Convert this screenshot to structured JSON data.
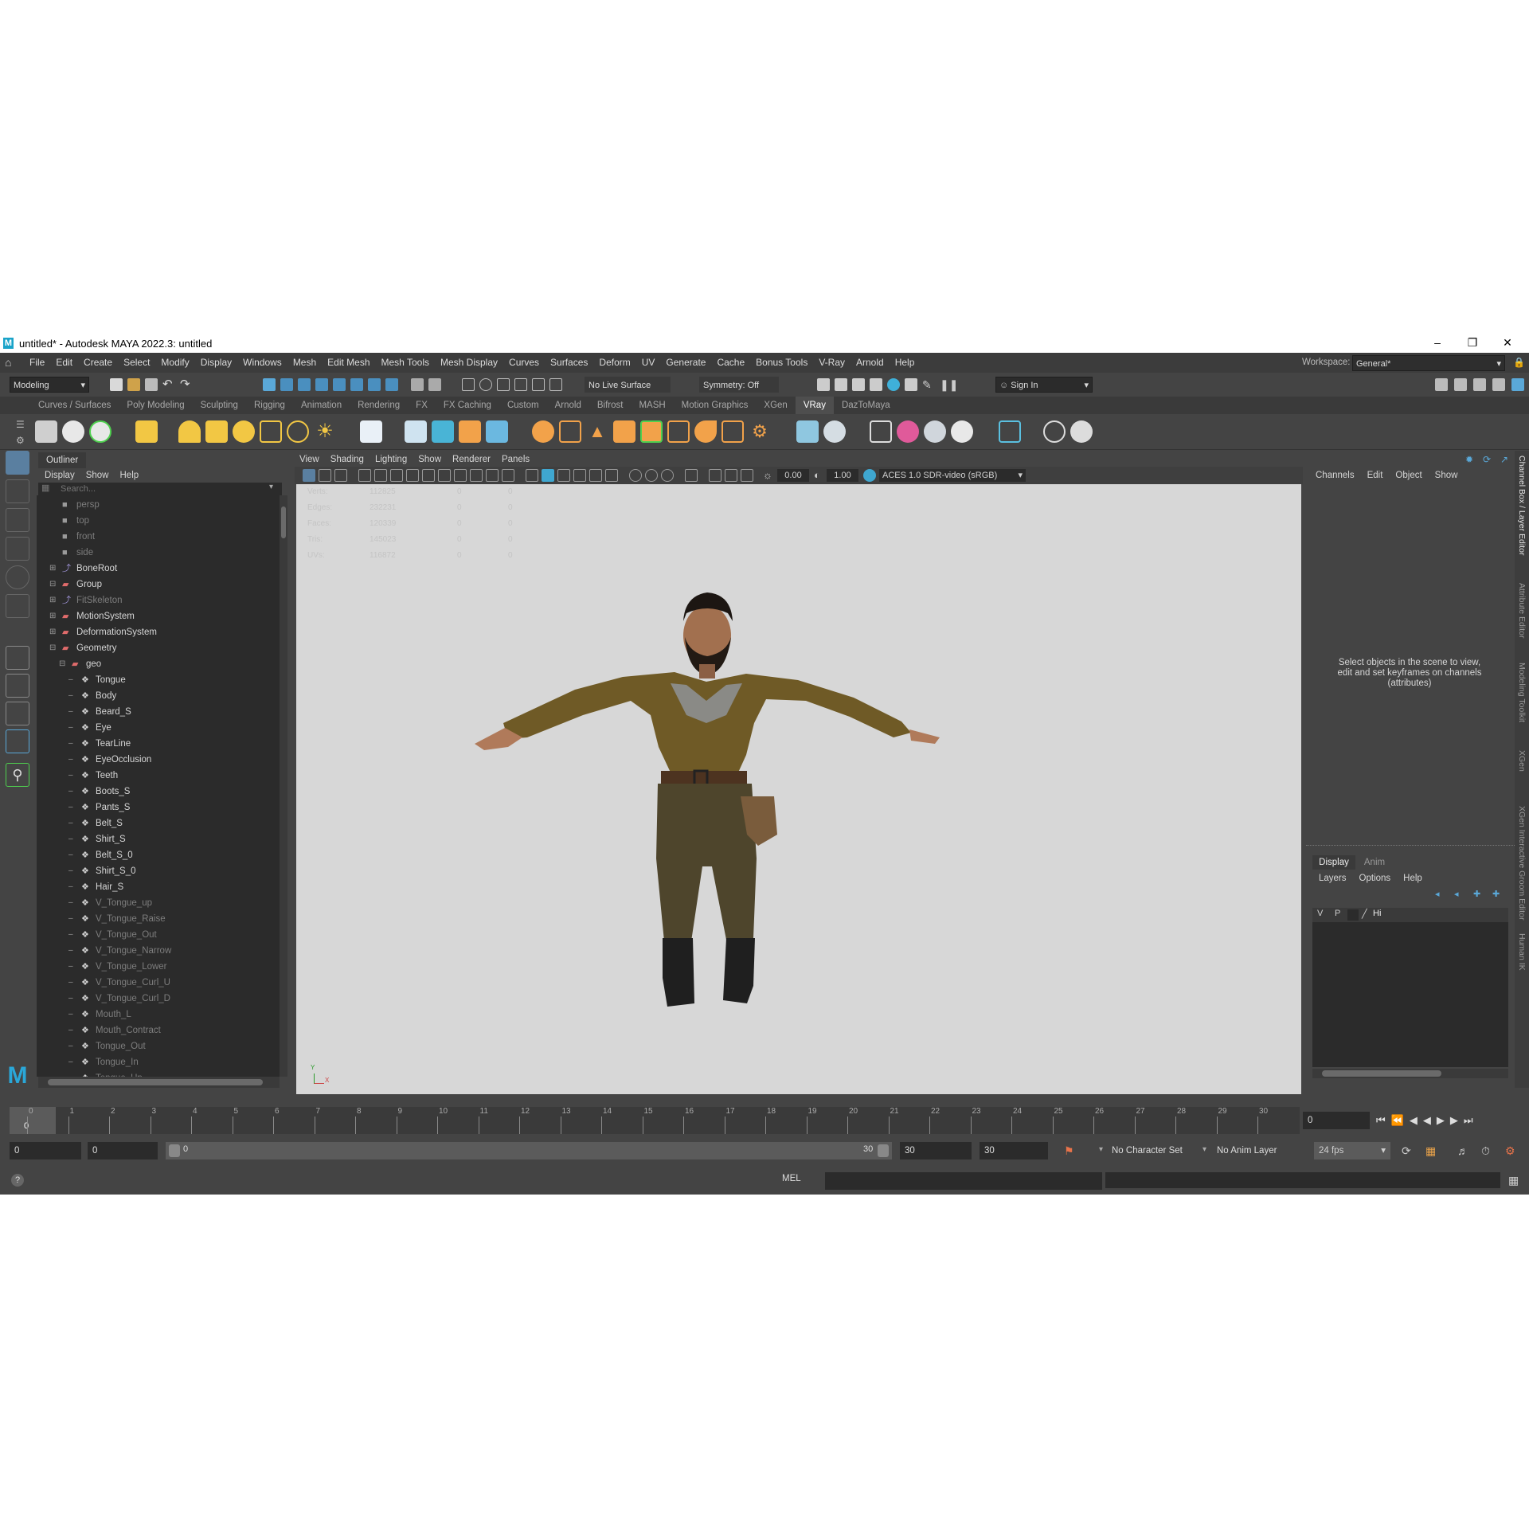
{
  "window": {
    "title": "untitled* - Autodesk MAYA 2022.3: untitled",
    "logo": "M"
  },
  "menu": [
    "File",
    "Edit",
    "Create",
    "Select",
    "Modify",
    "Display",
    "Windows",
    "Mesh",
    "Edit Mesh",
    "Mesh Tools",
    "Mesh Display",
    "Curves",
    "Surfaces",
    "Deform",
    "UV",
    "Generate",
    "Cache",
    "Bonus Tools",
    "V-Ray",
    "Arnold",
    "Help"
  ],
  "workspace": {
    "label": "Workspace:",
    "value": "General*"
  },
  "statusline": {
    "mode": "Modeling",
    "live_surface": "No Live Surface",
    "symmetry": "Symmetry: Off",
    "sign_in": "Sign In"
  },
  "shelf_tabs": [
    "Curves / Surfaces",
    "Poly Modeling",
    "Sculpting",
    "Rigging",
    "Animation",
    "Rendering",
    "FX",
    "FX Caching",
    "Custom",
    "Arnold",
    "Bifrost",
    "MASH",
    "Motion Graphics",
    "XGen",
    "VRay",
    "DazToMaya"
  ],
  "active_shelf_tab": "VRay",
  "outliner": {
    "title": "Outliner",
    "menu": [
      "Display",
      "Show",
      "Help"
    ],
    "search_placeholder": "Search...",
    "items": [
      {
        "label": "persp",
        "dim": true,
        "indent": 0,
        "kind": "camera"
      },
      {
        "label": "top",
        "dim": true,
        "indent": 0,
        "kind": "camera"
      },
      {
        "label": "front",
        "dim": true,
        "indent": 0,
        "kind": "camera"
      },
      {
        "label": "side",
        "dim": true,
        "indent": 0,
        "kind": "camera"
      },
      {
        "label": "BoneRoot",
        "dim": false,
        "indent": 0,
        "kind": "joint"
      },
      {
        "label": "Group",
        "dim": false,
        "indent": 0,
        "kind": "group"
      },
      {
        "label": "FitSkeleton",
        "dim": true,
        "indent": 1,
        "kind": "joint"
      },
      {
        "label": "MotionSystem",
        "dim": false,
        "indent": 1,
        "kind": "group"
      },
      {
        "label": "DeformationSystem",
        "dim": false,
        "indent": 1,
        "kind": "group"
      },
      {
        "label": "Geometry",
        "dim": false,
        "indent": 1,
        "kind": "group"
      },
      {
        "label": "geo",
        "dim": false,
        "indent": 2,
        "kind": "group"
      },
      {
        "label": "Tongue",
        "dim": false,
        "indent": 3,
        "kind": "mesh"
      },
      {
        "label": "Body",
        "dim": false,
        "indent": 3,
        "kind": "mesh"
      },
      {
        "label": "Beard_S",
        "dim": false,
        "indent": 3,
        "kind": "mesh"
      },
      {
        "label": "Eye",
        "dim": false,
        "indent": 3,
        "kind": "mesh"
      },
      {
        "label": "TearLine",
        "dim": false,
        "indent": 3,
        "kind": "mesh"
      },
      {
        "label": "EyeOcclusion",
        "dim": false,
        "indent": 3,
        "kind": "mesh"
      },
      {
        "label": "Teeth",
        "dim": false,
        "indent": 3,
        "kind": "mesh"
      },
      {
        "label": "Boots_S",
        "dim": false,
        "indent": 3,
        "kind": "mesh"
      },
      {
        "label": "Pants_S",
        "dim": false,
        "indent": 3,
        "kind": "mesh"
      },
      {
        "label": "Belt_S",
        "dim": false,
        "indent": 3,
        "kind": "mesh"
      },
      {
        "label": "Shirt_S",
        "dim": false,
        "indent": 3,
        "kind": "mesh"
      },
      {
        "label": "Belt_S_0",
        "dim": false,
        "indent": 3,
        "kind": "mesh"
      },
      {
        "label": "Shirt_S_0",
        "dim": false,
        "indent": 3,
        "kind": "mesh"
      },
      {
        "label": "Hair_S",
        "dim": false,
        "indent": 3,
        "kind": "mesh"
      },
      {
        "label": "V_Tongue_up",
        "dim": true,
        "indent": 3,
        "kind": "mesh"
      },
      {
        "label": "V_Tongue_Raise",
        "dim": true,
        "indent": 3,
        "kind": "mesh"
      },
      {
        "label": "V_Tongue_Out",
        "dim": true,
        "indent": 3,
        "kind": "mesh"
      },
      {
        "label": "V_Tongue_Narrow",
        "dim": true,
        "indent": 3,
        "kind": "mesh"
      },
      {
        "label": "V_Tongue_Lower",
        "dim": true,
        "indent": 3,
        "kind": "mesh"
      },
      {
        "label": "V_Tongue_Curl_U",
        "dim": true,
        "indent": 3,
        "kind": "mesh"
      },
      {
        "label": "V_Tongue_Curl_D",
        "dim": true,
        "indent": 3,
        "kind": "mesh"
      },
      {
        "label": "Mouth_L",
        "dim": true,
        "indent": 3,
        "kind": "mesh"
      },
      {
        "label": "Mouth_Contract",
        "dim": true,
        "indent": 3,
        "kind": "mesh"
      },
      {
        "label": "Tongue_Out",
        "dim": true,
        "indent": 3,
        "kind": "mesh"
      },
      {
        "label": "Tongue_In",
        "dim": true,
        "indent": 3,
        "kind": "mesh"
      },
      {
        "label": "Tongue_Up",
        "dim": true,
        "indent": 3,
        "kind": "mesh"
      }
    ]
  },
  "viewport": {
    "menu": [
      "View",
      "Shading",
      "Lighting",
      "Show",
      "Renderer",
      "Panels"
    ],
    "exposure": "0.00",
    "gamma": "1.00",
    "color_space": "ACES 1.0 SDR-video (sRGB)",
    "hud": [
      {
        "label": "Verts:",
        "v1": "112825",
        "v2": "0",
        "v3": "0"
      },
      {
        "label": "Edges:",
        "v1": "232231",
        "v2": "0",
        "v3": "0"
      },
      {
        "label": "Faces:",
        "v1": "120339",
        "v2": "0",
        "v3": "0"
      },
      {
        "label": "Tris:",
        "v1": "145023",
        "v2": "0",
        "v3": "0"
      },
      {
        "label": "UVs:",
        "v1": "116872",
        "v2": "0",
        "v3": "0"
      }
    ],
    "axis_y": "Y",
    "axis_x": "X"
  },
  "channel_box": {
    "menu": [
      "Channels",
      "Edit",
      "Object",
      "Show"
    ],
    "hint": "Select objects in the scene to view, edit and set keyframes on channels (attributes)"
  },
  "layer_editor": {
    "tabs": [
      "Display",
      "Anim"
    ],
    "menu": [
      "Layers",
      "Options",
      "Help"
    ],
    "layer_v": "V",
    "layer_p": "P",
    "layer_name": "Hi"
  },
  "side_tabs": [
    "Channel Box / Layer Editor",
    "Attribute Editor",
    "Modeling Toolkit",
    "XGen",
    "XGen Interactive Groom Editor",
    "Human IK"
  ],
  "timeline": {
    "ticks": [
      "0",
      "1",
      "2",
      "3",
      "4",
      "5",
      "6",
      "7",
      "8",
      "9",
      "10",
      "11",
      "12",
      "13",
      "14",
      "15",
      "16",
      "17",
      "18",
      "19",
      "20",
      "21",
      "22",
      "23",
      "24",
      "25",
      "26",
      "27",
      "28",
      "29",
      "30"
    ],
    "current_frame": "0",
    "current_field": "0"
  },
  "range": {
    "start": "0",
    "anim_start": "0",
    "slider_start": "0",
    "slider_end": "30",
    "anim_end": "30",
    "end": "30",
    "character_set": "No Character Set",
    "anim_layer": "No Anim Layer",
    "fps": "24 fps"
  },
  "command": {
    "language": "MEL"
  }
}
